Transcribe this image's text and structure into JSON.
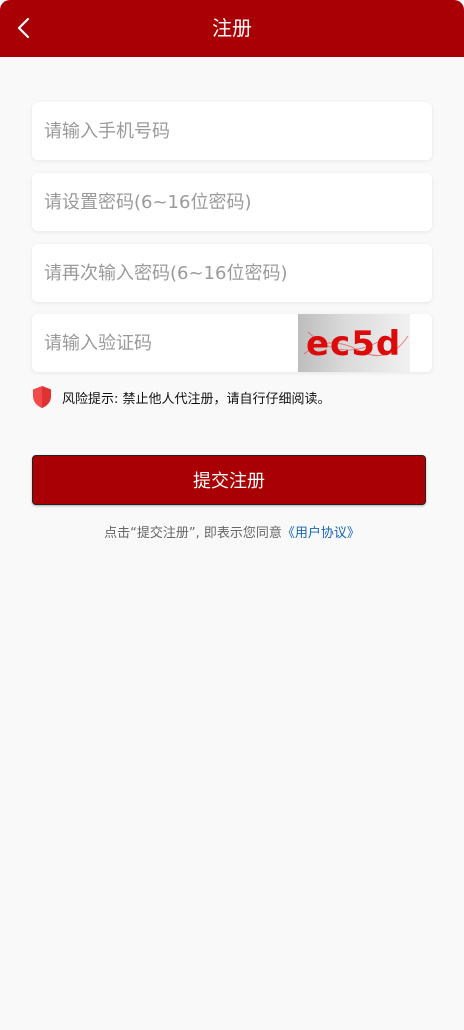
{
  "header": {
    "title": "注册",
    "back_icon": "chevron-left-icon"
  },
  "form": {
    "phone_placeholder": "请输入手机号码",
    "password_placeholder": "请设置密码(6~16位密码)",
    "confirm_placeholder": "请再次输入密码(6~16位密码)",
    "captcha_placeholder": "请输入验证码",
    "captcha_text": "ec5d"
  },
  "risk": {
    "icon": "shield-icon",
    "text": "风险提示: 禁止他人代注册，请自行仔细阅读。"
  },
  "submit_label": "提交注册",
  "agreement": {
    "prefix": "点击“提交注册”, 即表示您同意",
    "link": "《用户协议》"
  },
  "colors": {
    "brand": "#a80004",
    "link": "#1764b8",
    "shield": "#f24a4a"
  }
}
